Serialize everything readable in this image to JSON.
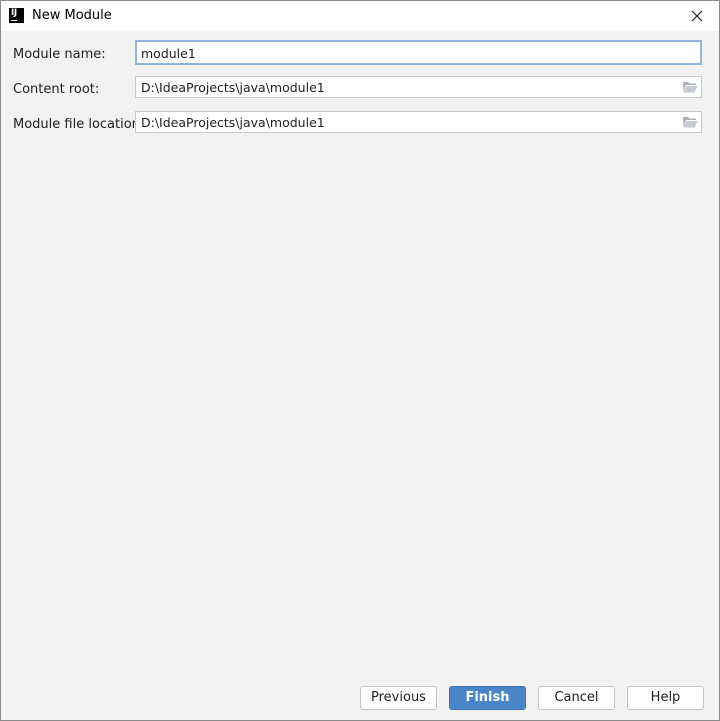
{
  "window": {
    "title": "New Module"
  },
  "form": {
    "module_name": {
      "label": "Module name:",
      "value": "module1"
    },
    "content_root": {
      "label": "Content root:",
      "value": "D:\\IdeaProjects\\java\\module1"
    },
    "module_file_location": {
      "label": "Module file location:",
      "value": "D:\\IdeaProjects\\java\\module1"
    }
  },
  "buttons": {
    "previous": "Previous",
    "finish": "Finish",
    "cancel": "Cancel",
    "help": "Help"
  },
  "icons": {
    "app": "intellij-idea-icon",
    "close": "close-icon",
    "browse": "folder-icon"
  },
  "colors": {
    "dialog_background": "#f2f2f2",
    "primary_button": "#4a86c7",
    "focus_border": "#8fb5e3"
  }
}
